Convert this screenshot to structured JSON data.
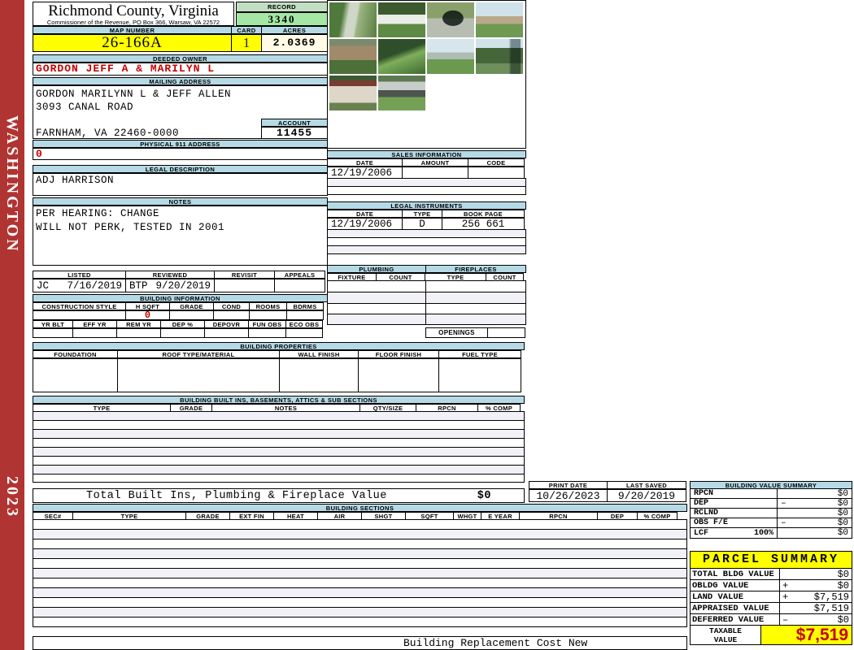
{
  "colors": {
    "sidebar_red": "#B03431",
    "section_bar_blue": "#B5DAE6",
    "highlight_yellow": "#FFFF00",
    "record_green": "#A4E7A4",
    "acres_cream": "#FFFBE6",
    "accent_red": "#C40000"
  },
  "sidebar": {
    "state": "WASHINGTON",
    "year": "2023"
  },
  "header": {
    "title": "Richmond County, Virginia",
    "subtitle": "Commissioner of the Revenue, PO Box 366, Warsaw, VA 22572",
    "record_label": "RECORD",
    "record_value": "3340",
    "map_number_label": "MAP NUMBER",
    "map_number": "26-166A",
    "card_label": "CARD",
    "card": "1",
    "acres_label": "ACRES",
    "acres": "2.0369"
  },
  "owner": {
    "deeded_label": "DEEDED OWNER",
    "deeded_name": "GORDON JEFF A & MARILYN L",
    "mailing_label": "MAILING ADDRESS",
    "mailing_line1": "GORDON MARILYNN L & JEFF ALLEN",
    "mailing_line2": "3093 CANAL ROAD",
    "mailing_line3": "FARNHAM, VA 22460-0000",
    "account_label": "ACCOUNT",
    "account_value": "11455",
    "physical_label": "PHYSICAL 911 ADDRESS",
    "physical_value": "0"
  },
  "legal_description": {
    "label": "LEGAL DESCRIPTION",
    "value": "ADJ HARRISON"
  },
  "notes": {
    "label": "NOTES",
    "line1": "PER HEARING: CHANGE",
    "line2": "WILL NOT PERK, TESTED IN 2001"
  },
  "review": {
    "listed_label": "LISTED",
    "listed_by": "JC",
    "listed_date": "7/16/2019",
    "reviewed_label": "REVIEWED",
    "reviewed_by": "BTP",
    "reviewed_date": "9/20/2019",
    "revisit_label": "REVISIT",
    "appeals_label": "APPEALS"
  },
  "building_information": {
    "title": "BUILDING INFORMATION",
    "row1_headers": [
      "CONSTRUCTION STYLE",
      "H SQFT",
      "GRADE",
      "COND",
      "ROOMS",
      "BDRMS"
    ],
    "h_sqft_value": "0",
    "row2_headers": [
      "YR BLT",
      "EFF YR",
      "REM YR",
      "DEP %",
      "DEPOVR",
      "FUN OBS",
      "ECO OBS"
    ]
  },
  "building_properties": {
    "title": "BUILDING PROPERTIES",
    "headers": [
      "FOUNDATION",
      "ROOF TYPE/MATERIAL",
      "WALL FINISH",
      "FLOOR FINISH",
      "FUEL TYPE"
    ]
  },
  "built_ins": {
    "title": "BUILDING BUILT INS, BASEMENTS, ATTICS & SUB SECTIONS",
    "headers": [
      "TYPE",
      "GRADE",
      "NOTES",
      "QTY/SIZE",
      "RPCN",
      "% COMP"
    ],
    "total_label": "Total Built Ins, Plumbing & Fireplace Value",
    "total_value": "$0"
  },
  "sales": {
    "title": "SALES INFORMATION",
    "headers": [
      "DATE",
      "AMOUNT",
      "CODE"
    ],
    "rows": [
      {
        "date": "12/19/2006",
        "amount": "",
        "code": ""
      }
    ]
  },
  "legal_instruments": {
    "title": "LEGAL INSTRUMENTS",
    "headers": [
      "DATE",
      "TYPE",
      "BOOK PAGE"
    ],
    "rows": [
      {
        "date": "12/19/2006",
        "type": "D",
        "book_page": "256 661"
      }
    ]
  },
  "plumbing": {
    "title": "PLUMBING",
    "headers": [
      "FIXTURE",
      "COUNT"
    ]
  },
  "fireplaces": {
    "title": "FIREPLACES",
    "headers": [
      "TYPE",
      "COUNT"
    ],
    "openings_label": "OPENINGS"
  },
  "print_info": {
    "print_date_label": "PRINT DATE",
    "print_date": "10/26/2023",
    "last_saved_label": "LAST SAVED",
    "last_saved": "9/20/2019"
  },
  "building_value_summary": {
    "title": "BUILDING VALUE SUMMARY",
    "rows": [
      {
        "label": "RPCN",
        "pct": "",
        "op": "",
        "value": "$0"
      },
      {
        "label": "DEP",
        "pct": "",
        "op": "–",
        "value": "$0"
      },
      {
        "label": "RCLND",
        "pct": "",
        "op": "",
        "value": "$0"
      },
      {
        "label": "OBS F/E",
        "pct": "",
        "op": "–",
        "value": "$0"
      },
      {
        "label": "LCF",
        "pct": "100%",
        "op": "",
        "value": "$0"
      }
    ]
  },
  "building_sections": {
    "title": "BUILDING SECTIONS",
    "headers": [
      "SEC#",
      "TYPE",
      "GRADE",
      "EXT FIN",
      "HEAT",
      "AIR",
      "SHGT",
      "SQFT",
      "WHGT",
      "E YEAR",
      "RPCN",
      "DEP",
      "% COMP"
    ],
    "footer": "Building Replacement Cost New"
  },
  "parcel_summary": {
    "title": "PARCEL SUMMARY",
    "rows": [
      {
        "label": "TOTAL BLDG VALUE",
        "op": "",
        "value": "$0"
      },
      {
        "label": "OBLDG VALUE",
        "op": "+",
        "value": "$0"
      },
      {
        "label": "LAND VALUE",
        "op": "+",
        "value": "$7,519"
      },
      {
        "label": "APPRAISED VALUE",
        "op": "",
        "value": "$7,519"
      },
      {
        "label": "DEFERRED VALUE",
        "op": "–",
        "value": "$0"
      }
    ],
    "taxable_label_line1": "TAXABLE",
    "taxable_label_line2": "VALUE",
    "taxable_value": "$7,519"
  },
  "photos": {
    "descriptions": [
      "driveway between trees",
      "white fence with shrubs",
      "mailbox at road",
      "house with lawn",
      "house porch closeup",
      "yard plants",
      "neighborhood houses",
      "trees and parked car",
      "white shed with red roof",
      "carport"
    ]
  }
}
